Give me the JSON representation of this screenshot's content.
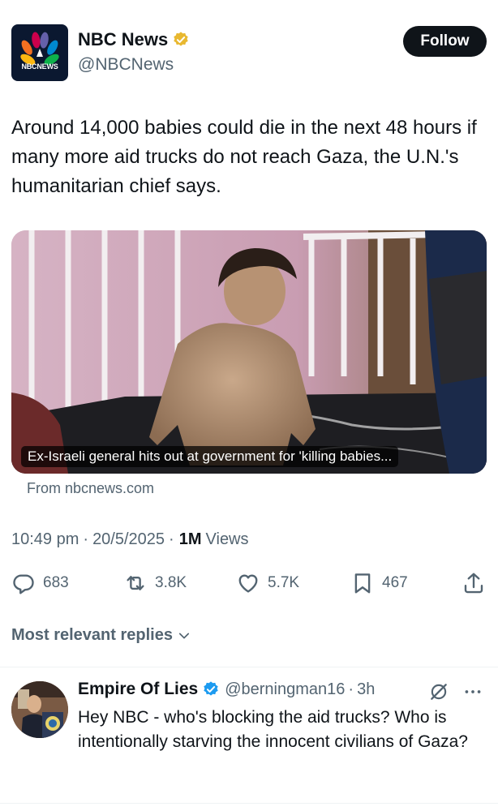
{
  "post": {
    "author": {
      "name": "NBC News",
      "handle": "@NBCNews",
      "logo_text": "NBCNEWS",
      "verified_badge": "gold-verified-icon"
    },
    "follow_label": "Follow",
    "text": "Around 14,000 babies could die in the next 48 hours if many more aid trucks do not reach Gaza, the U.N.'s humanitarian chief says.",
    "card": {
      "caption": "Ex-Israeli general hits out at government for 'killing babies...",
      "source": "From nbcnews.com"
    },
    "time": "10:49 pm",
    "date": "20/5/2025",
    "separator": "·",
    "views_count": "1M",
    "views_label": "Views",
    "stats": {
      "replies": "683",
      "reposts": "3.8K",
      "likes": "5.7K",
      "bookmarks": "467"
    }
  },
  "replies_section": {
    "label": "Most relevant replies"
  },
  "reply": {
    "name": "Empire Of Lies",
    "handle": "@berningman16",
    "separator": "·",
    "time": "3h",
    "text": "Hey NBC - who's blocking the aid trucks? Who is intentionally starving the innocent civilians of Gaza?"
  },
  "colors": {
    "text_primary": "#0f1419",
    "text_secondary": "#536471",
    "gold_badge": "#e8b830",
    "blue_badge": "#1d9bf0"
  }
}
